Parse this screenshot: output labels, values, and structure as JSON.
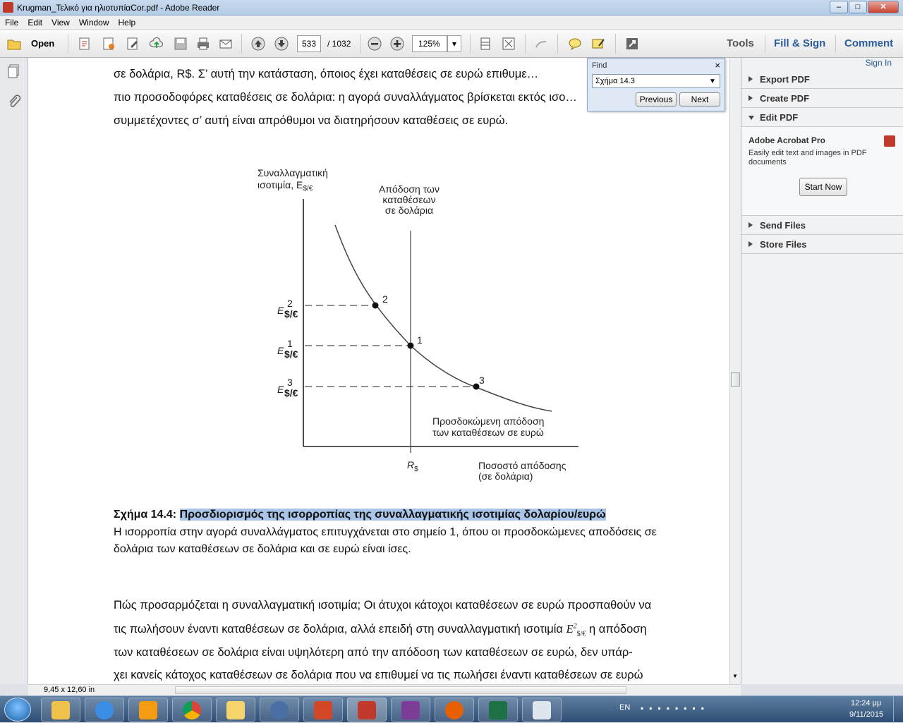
{
  "window": {
    "title": "Krugman_Τελικό για ηλιοτυπίαCor.pdf - Adobe Reader",
    "min": "–",
    "max": "□",
    "close": "✕"
  },
  "menu": [
    "File",
    "Edit",
    "View",
    "Window",
    "Help"
  ],
  "toolbar": {
    "open_label": "Open",
    "page_current": "533",
    "page_total": "/ 1032",
    "zoom": "125%",
    "tools": "Tools",
    "fill_sign": "Fill & Sign",
    "comment": "Comment"
  },
  "find": {
    "title": "Find",
    "query": "Σχήμα 14.3",
    "previous": "Previous",
    "next": "Next",
    "close": "×"
  },
  "right_panel": {
    "sign_in": "Sign In",
    "sections": [
      "Export PDF",
      "Create PDF",
      "Edit PDF"
    ],
    "promo_title": "Adobe Acrobat Pro",
    "promo_text_1": "Easily edit text and images in PDF",
    "promo_text_2": "documents",
    "start_now": "Start Now",
    "bottom_sections": [
      "Send Files",
      "Store Files"
    ]
  },
  "document": {
    "top_lines": [
      "σε δολάρια, R$. Σ’ αυτή την κατάσταση, όποιος έχει καταθέσεις σε ευρώ επιθυμε…",
      "πιο προσοδοφόρες καταθέσεις σε δολάρια: η αγορά συναλλάγματος βρίσκεται εκτός ισο…",
      "συμμετέχοντες σ’ αυτή είναι απρόθυμοι να διατηρήσουν καταθέσεις σε ευρώ."
    ],
    "figure": {
      "y_label_1": "Συναλλαγματική",
      "y_label_2": "ισοτιμία, E",
      "y_label_sub": "$/€",
      "vline_label_1": "Απόδοση των",
      "vline_label_2": "καταθέσεων",
      "vline_label_3": "σε δολάρια",
      "curve_label_1": "Προσδοκώμενη απόδοση",
      "curve_label_2": "των καταθέσεων σε ευρώ",
      "x_label_1": "Ποσοστό απόδοσης",
      "x_label_2": "(σε δολάρια)",
      "x_tick": "R",
      "x_tick_sub": "$",
      "e_main": "E",
      "e_sub": "$/€",
      "points": [
        {
          "name": "2",
          "sup": "2"
        },
        {
          "name": "1",
          "sup": "1"
        },
        {
          "name": "3",
          "sup": "3"
        }
      ]
    },
    "caption_label": "Σχήμα 14.4: ",
    "caption_title": "Προσδιορισμός της ισορροπίας της συναλλαγματικής ισοτιμίας δολαρίου/ευρώ",
    "caption_line_1": "Η ισορροπία στην αγορά συναλλάγματος επιτυγχάνεται στο σημείο 1, όπου οι προσδοκώμενες αποδόσεις σε",
    "caption_line_2": "δολάρια των καταθέσεων σε δολάρια και σε ευρώ είναι ίσες.",
    "body_lines": [
      "Πώς προσαρμόζεται η συναλλαγματική ισοτιμία; Οι άτυχοι κάτοχοι καταθέσεων σε ευρώ προσπαθούν να",
      "τις πωλήσουν έναντι καταθέσεων σε δολάρια, αλλά επειδή στη συναλλαγματική ισοτιμία",
      "η απόδοση",
      "των καταθέσεων σε δολάρια είναι υψηλότερη από την απόδοση των καταθέσεων σε ευρώ, δεν υπάρ-",
      "χει κανείς κάτοχος καταθέσεων σε δολάρια που να επιθυμεί να τις πωλήσει έναντι καταθέσεων σε ευρώ"
    ]
  },
  "status": {
    "page_size": "9,45 x 12,60 in"
  },
  "taskbar": {
    "lang": "EN",
    "time": "12:24 μμ",
    "date": "9/11/2015"
  }
}
